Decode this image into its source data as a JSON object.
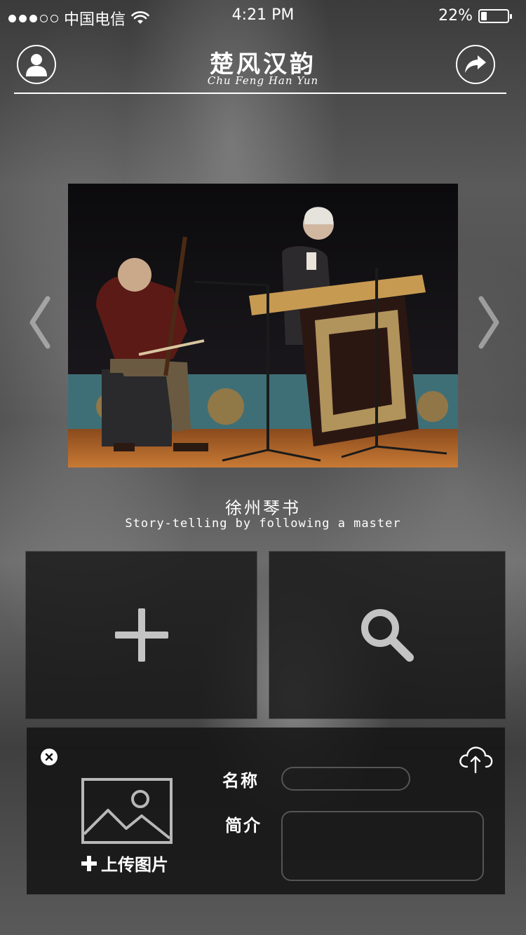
{
  "status_bar": {
    "carrier": "中国电信",
    "time": "4:21 PM",
    "battery_text": "22%",
    "battery_level": 0.22,
    "signal_filled": 3,
    "signal_total": 5
  },
  "nav": {
    "title": "楚风汉韵",
    "subtitle": "Chu Feng Han Yun",
    "left_icon": "user-icon",
    "right_icon": "share-icon"
  },
  "carousel": {
    "caption_cn": "徐州琴书",
    "caption_en": "Story-telling by following a master",
    "prev_icon": "chevron-left-icon",
    "next_icon": "chevron-right-icon"
  },
  "actions": {
    "add_icon": "plus-icon",
    "search_icon": "search-icon"
  },
  "upload_form": {
    "upload_label": "上传图片",
    "name_label": "名称",
    "intro_label": "简介",
    "name_value": "",
    "intro_value": "",
    "close_icon": "close-icon",
    "cloud_icon": "cloud-upload-icon"
  },
  "colors": {
    "text": "#ffffff",
    "tile_bg": "#161616",
    "input_border": "#555555"
  }
}
